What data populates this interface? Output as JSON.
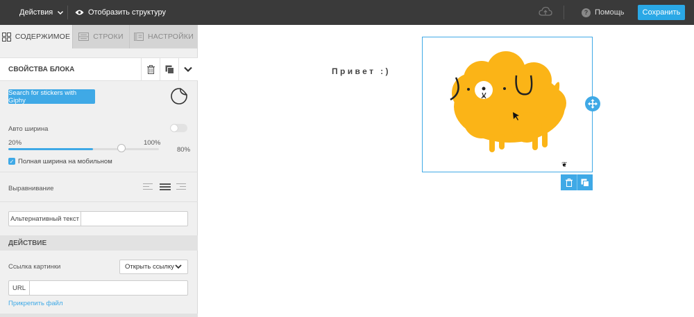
{
  "topbar": {
    "actions_label": "Действия",
    "structure_label": "Отобразить структуру",
    "help_label": "Помощь",
    "save_label": "Сохранить",
    "icons": [
      "chevron-down-icon",
      "eye-icon",
      "cloud-upload-icon",
      "question-icon"
    ]
  },
  "panel": {
    "tabs": [
      {
        "label": "Содержимое",
        "icon": "grid-icon",
        "active": true
      },
      {
        "label": "Строки",
        "icon": "rows-icon",
        "active": false
      },
      {
        "label": "Настройки",
        "icon": "settings-icon",
        "active": false
      }
    ],
    "block_title": "Свойства блока",
    "giphy_button": "Search for stickers with Giphy",
    "auto_width_label": "Авто ширина",
    "auto_width_enabled": false,
    "slider": {
      "min_label": "20%",
      "max_label": "100%",
      "value_label": "80%",
      "value": 80
    },
    "full_width_mobile_label": "Полная ширина на мобильном",
    "full_width_mobile_checked": true,
    "alignment_label": "Выравнивание",
    "alignment_selected": "center",
    "alt_text_label": "Альтернативный текст",
    "alt_text_value": "",
    "action_section": "Действие",
    "image_link_label": "Ссылка картинки",
    "image_link_option": "Открыть ссылку",
    "url_label": "URL",
    "url_value": "",
    "attach_file": "Прикрепить файл"
  },
  "canvas": {
    "greeting": "Привет :)",
    "accent": "#3fa9e6",
    "dog_color": "#fbb417"
  }
}
